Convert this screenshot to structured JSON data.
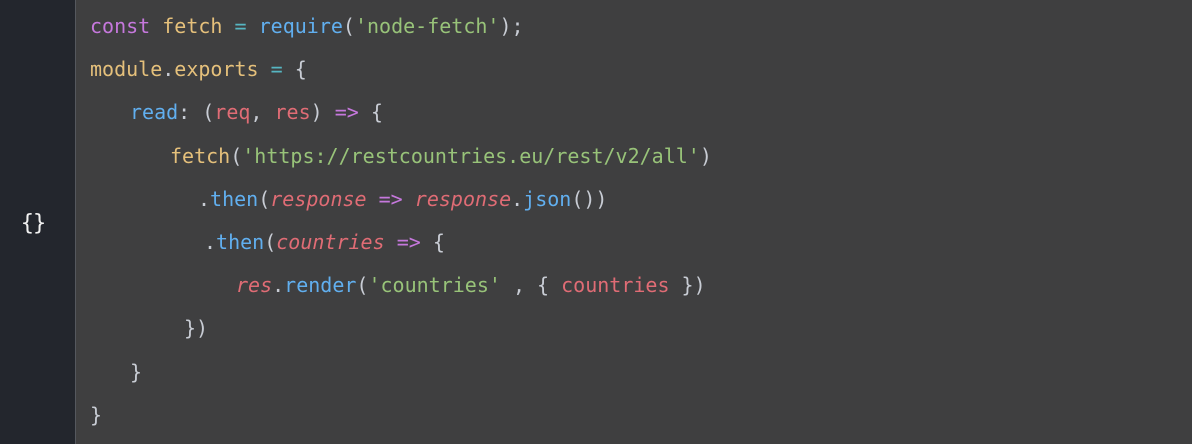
{
  "gutter": {
    "icon_glyph": "{}",
    "icon_name": "braces-icon"
  },
  "code": {
    "lines": [
      [
        {
          "t": "const",
          "c": "kw"
        },
        {
          "t": " ",
          "c": "punc"
        },
        {
          "t": "fetch",
          "c": "var"
        },
        {
          "t": " ",
          "c": "punc"
        },
        {
          "t": "=",
          "c": "op"
        },
        {
          "t": " ",
          "c": "punc"
        },
        {
          "t": "require",
          "c": "fn"
        },
        {
          "t": "(",
          "c": "punc"
        },
        {
          "t": "'node-fetch'",
          "c": "str"
        },
        {
          "t": ");",
          "c": "punc"
        }
      ],
      [
        {
          "t": "module",
          "c": "var"
        },
        {
          "t": ".",
          "c": "punc"
        },
        {
          "t": "exports",
          "c": "var"
        },
        {
          "t": " ",
          "c": "punc"
        },
        {
          "t": "=",
          "c": "op"
        },
        {
          "t": " {",
          "c": "punc"
        }
      ],
      [
        {
          "t": "read",
          "c": "prop"
        },
        {
          "t": ": (",
          "c": "punc"
        },
        {
          "t": "req",
          "c": "param"
        },
        {
          "t": ", ",
          "c": "punc"
        },
        {
          "t": "res",
          "c": "param"
        },
        {
          "t": ") ",
          "c": "punc"
        },
        {
          "t": "=>",
          "c": "kw"
        },
        {
          "t": " {",
          "c": "punc"
        }
      ],
      [
        {
          "t": "fetch",
          "c": "var"
        },
        {
          "t": "(",
          "c": "punc"
        },
        {
          "t": "'https://restcountries.eu/rest/v2/all'",
          "c": "str"
        },
        {
          "t": ")",
          "c": "punc"
        }
      ],
      [
        {
          "t": ".",
          "c": "punc"
        },
        {
          "t": "then",
          "c": "fn"
        },
        {
          "t": "(",
          "c": "punc"
        },
        {
          "t": "response",
          "c": "ital"
        },
        {
          "t": " ",
          "c": "punc"
        },
        {
          "t": "=>",
          "c": "kw"
        },
        {
          "t": " ",
          "c": "punc"
        },
        {
          "t": "response",
          "c": "ital"
        },
        {
          "t": ".",
          "c": "punc"
        },
        {
          "t": "json",
          "c": "fn"
        },
        {
          "t": "())",
          "c": "punc"
        }
      ],
      [
        {
          "t": ".",
          "c": "punc"
        },
        {
          "t": "then",
          "c": "fn"
        },
        {
          "t": "(",
          "c": "punc"
        },
        {
          "t": "countries",
          "c": "ital"
        },
        {
          "t": " ",
          "c": "punc"
        },
        {
          "t": "=>",
          "c": "kw"
        },
        {
          "t": " {",
          "c": "punc"
        }
      ],
      [
        {
          "t": "res",
          "c": "ital"
        },
        {
          "t": ".",
          "c": "punc"
        },
        {
          "t": "render",
          "c": "fn"
        },
        {
          "t": "(",
          "c": "punc"
        },
        {
          "t": "'countries'",
          "c": "str"
        },
        {
          "t": " , { ",
          "c": "punc"
        },
        {
          "t": "countries",
          "c": "param"
        },
        {
          "t": " })",
          "c": "punc"
        }
      ],
      [
        {
          "t": "})",
          "c": "punc"
        }
      ],
      [
        {
          "t": "}",
          "c": "punc"
        }
      ],
      [
        {
          "t": "}",
          "c": "punc"
        }
      ]
    ]
  },
  "colors": {
    "background": "#3f3f40",
    "gutter": "#23262d",
    "keyword": "#c678dd",
    "variable": "#e5c07b",
    "function": "#61afef",
    "string": "#98c379",
    "parameter": "#e06c75"
  }
}
